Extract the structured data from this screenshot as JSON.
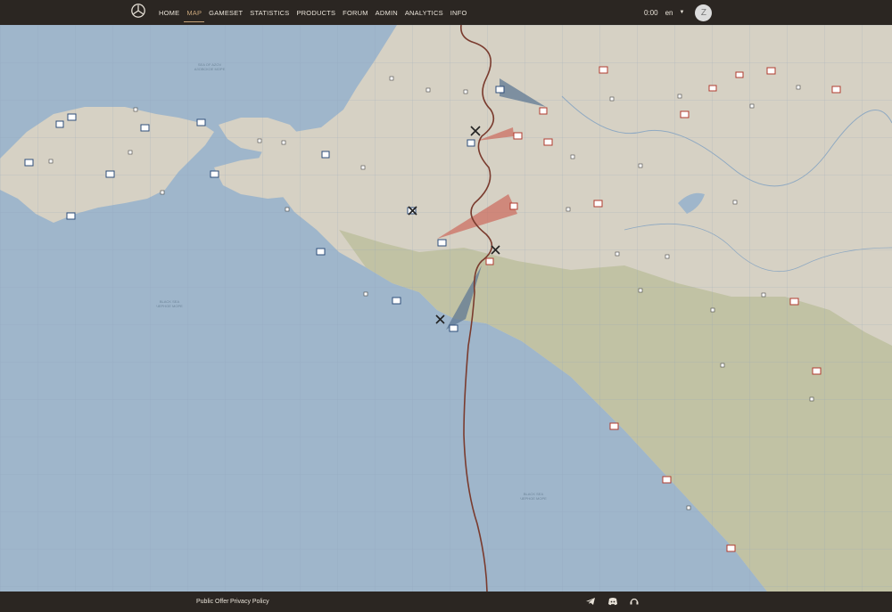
{
  "nav": {
    "items": [
      {
        "label": "HOME",
        "active": false
      },
      {
        "label": "MAP",
        "active": true
      },
      {
        "label": "GAMESET",
        "active": false
      },
      {
        "label": "STATISTICS",
        "active": false
      },
      {
        "label": "PRODUCTS",
        "active": false
      },
      {
        "label": "FORUM",
        "active": false
      },
      {
        "label": "ADMIN",
        "active": false
      },
      {
        "label": "ANALYTICS",
        "active": false
      },
      {
        "label": "INFO",
        "active": false
      }
    ]
  },
  "header": {
    "time": "0:00",
    "language": "en",
    "avatar_initial": "Z"
  },
  "map": {
    "colors": {
      "sea": "#9fb6cb",
      "land": "#d6d1c4",
      "highland": "#c1c2a4",
      "front_line": "#7a3b2e",
      "allied": "#5f7894",
      "enemy": "#cc6a5c"
    },
    "sea_labels": [
      {
        "line1": "SEA OF AZOV",
        "line2": "АЗОВСКОЕ МОРЕ"
      },
      {
        "line1": "BLACK SEA",
        "line2": "ЧЕРНОЕ МОРЕ"
      },
      {
        "line1": "BLACK SEA",
        "line2": "ЧЕРНОЕ МОРЕ"
      }
    ]
  },
  "footer": {
    "public_offer": "Public Offer",
    "privacy_policy": "Privacy Policy",
    "icons": [
      "telegram-icon",
      "discord-icon",
      "support-icon"
    ]
  }
}
